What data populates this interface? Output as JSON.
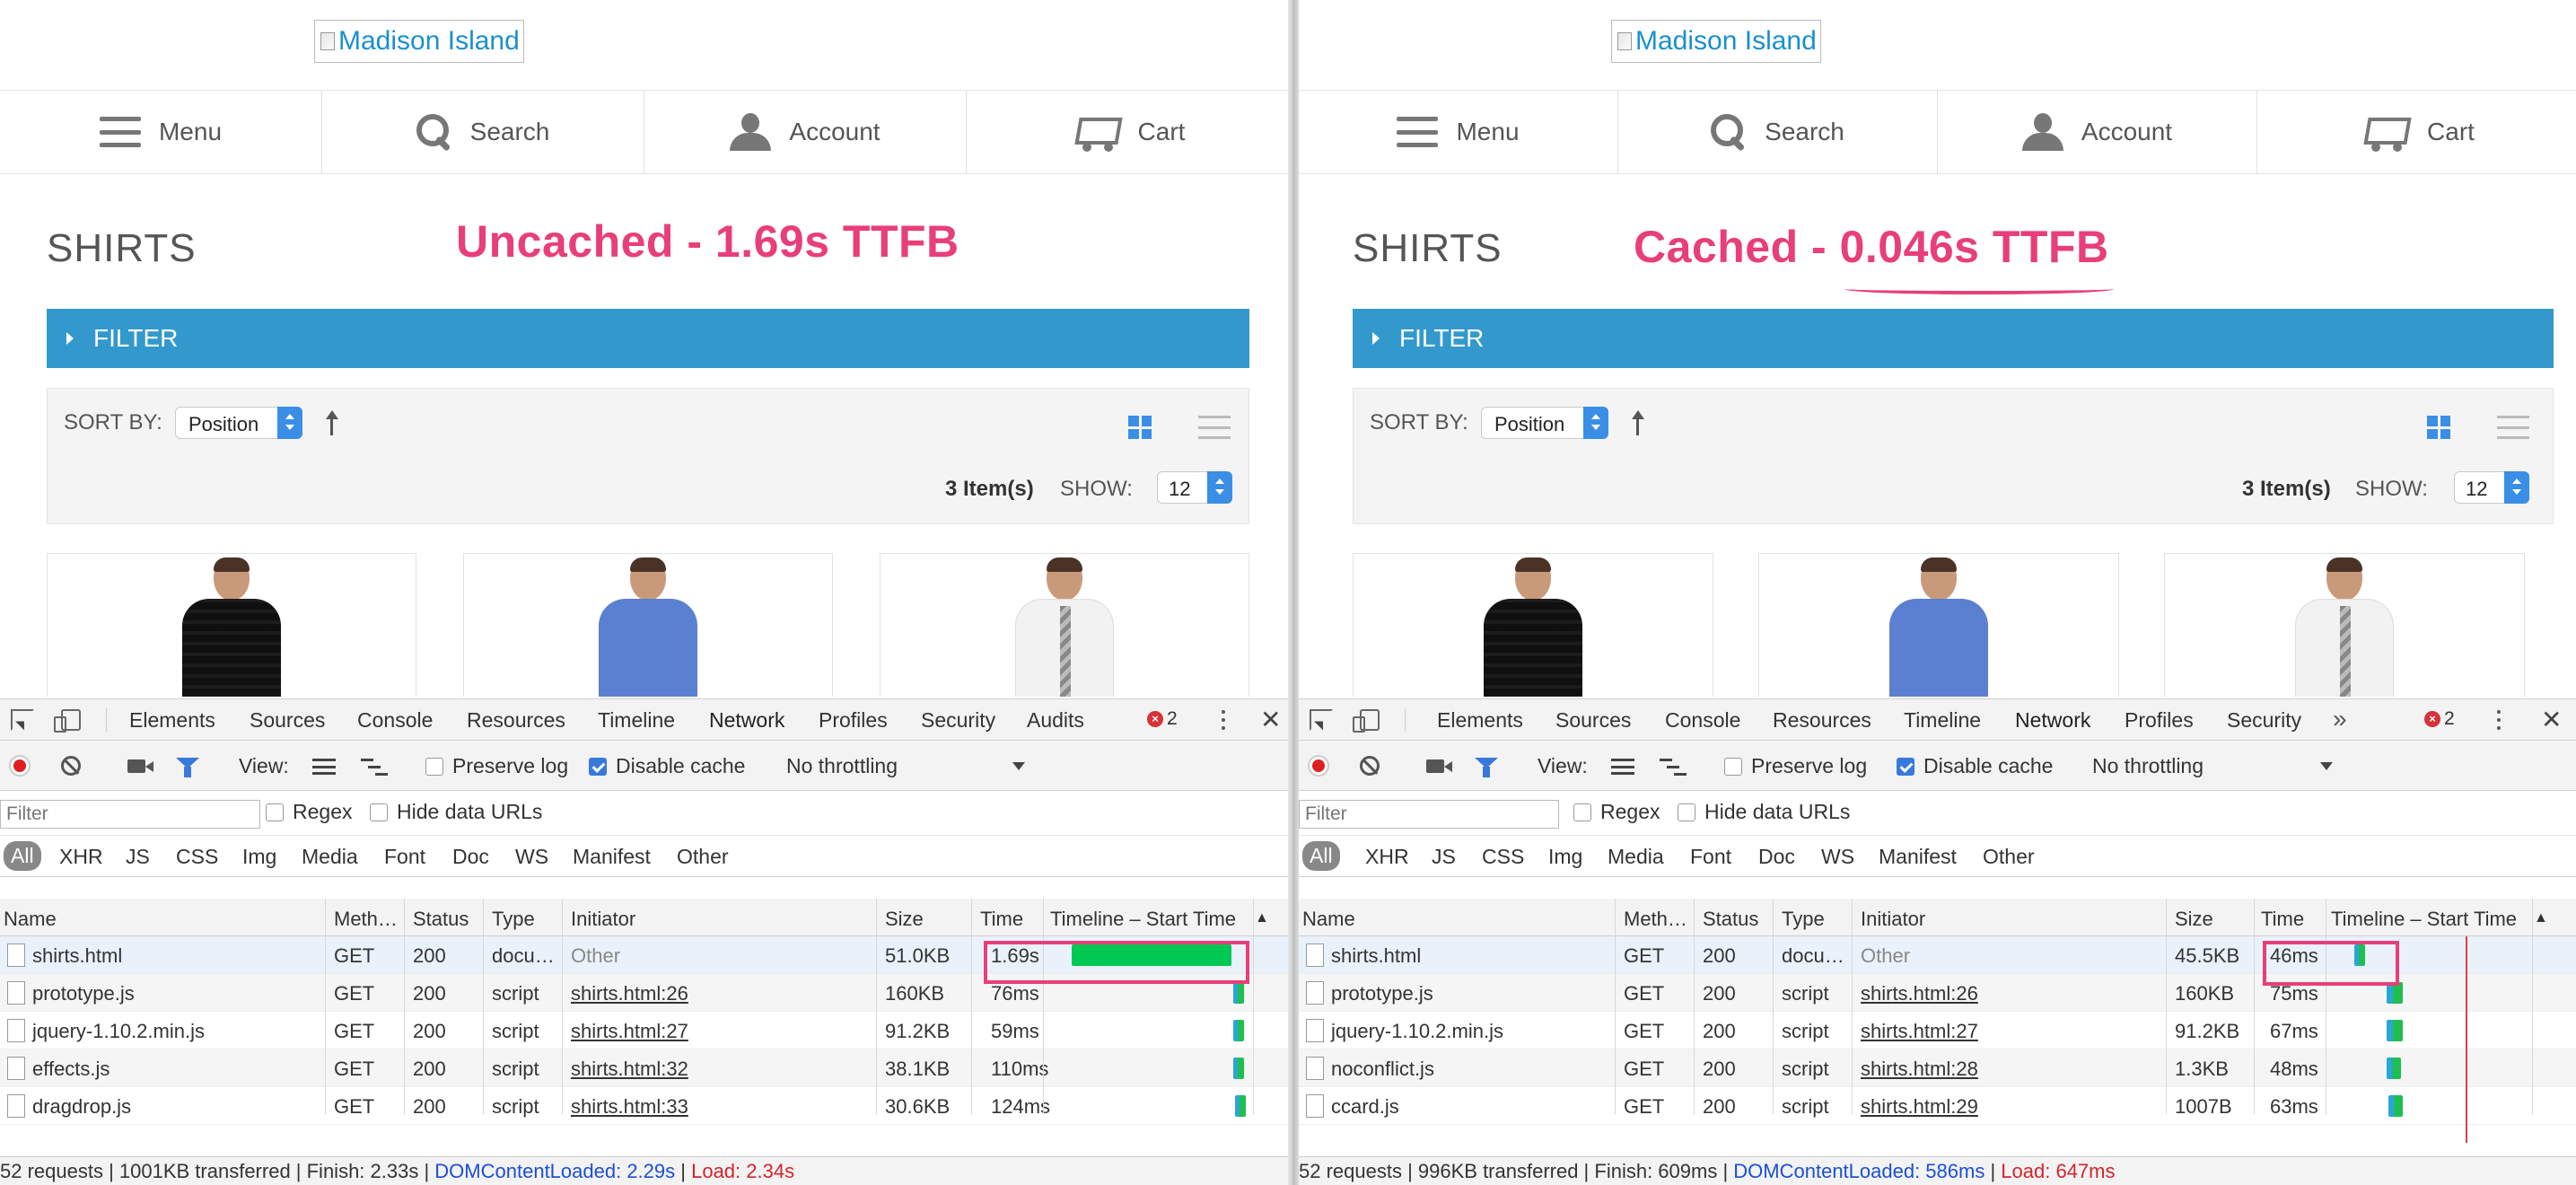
{
  "site": {
    "logo_alt": "Madison Island",
    "nav": [
      "Menu",
      "Search",
      "Account",
      "Cart"
    ],
    "category_title": "SHIRTS",
    "filter_label": "FILTER",
    "sort_by_label": "SORT BY:",
    "sort_value": "Position",
    "items_count": "3 Item(s)",
    "show_label": "SHOW:",
    "show_value": "12"
  },
  "annotations": {
    "left": "Uncached - 1.69s TTFB",
    "right_prefix": "Cached - ",
    "right_value": "0.046s TTFB"
  },
  "accent_color": "#e83e7a",
  "devtools": {
    "tabs_left": [
      "Elements",
      "Sources",
      "Console",
      "Resources",
      "Timeline",
      "Network",
      "Profiles",
      "Security",
      "Audits"
    ],
    "tabs_right": [
      "Elements",
      "Sources",
      "Console",
      "Resources",
      "Timeline",
      "Network",
      "Profiles",
      "Security"
    ],
    "more_tabs": "»",
    "active_tab": "Network",
    "error_count": "2",
    "close": "✕",
    "view_label": "View:",
    "preserve_log": "Preserve log",
    "disable_cache": "Disable cache",
    "throttling": "No throttling",
    "filter_placeholder": "Filter",
    "regex": "Regex",
    "hide_data_urls": "Hide data URLs",
    "types": [
      "All",
      "XHR",
      "JS",
      "CSS",
      "Img",
      "Media",
      "Font",
      "Doc",
      "WS",
      "Manifest",
      "Other"
    ],
    "columns": [
      "Name",
      "Meth…",
      "Status",
      "Type",
      "Initiator",
      "Size",
      "Time",
      "Timeline – Start Time"
    ],
    "sort_marker": "▲"
  },
  "left_requests": [
    {
      "name": "shirts.html",
      "method": "GET",
      "status": "200",
      "type": "docu…",
      "initiator": "Other",
      "size": "51.0KB",
      "time": "1.69s"
    },
    {
      "name": "prototype.js",
      "method": "GET",
      "status": "200",
      "type": "script",
      "initiator": "shirts.html:26",
      "size": "160KB",
      "time": "76ms"
    },
    {
      "name": "jquery-1.10.2.min.js",
      "method": "GET",
      "status": "200",
      "type": "script",
      "initiator": "shirts.html:27",
      "size": "91.2KB",
      "time": "59ms"
    },
    {
      "name": "effects.js",
      "method": "GET",
      "status": "200",
      "type": "script",
      "initiator": "shirts.html:32",
      "size": "38.1KB",
      "time": "110ms"
    },
    {
      "name": "dragdrop.js",
      "method": "GET",
      "status": "200",
      "type": "script",
      "initiator": "shirts.html:33",
      "size": "30.6KB",
      "time": "124ms"
    }
  ],
  "right_requests": [
    {
      "name": "shirts.html",
      "method": "GET",
      "status": "200",
      "type": "docu…",
      "initiator": "Other",
      "size": "45.5KB",
      "time": "46ms"
    },
    {
      "name": "prototype.js",
      "method": "GET",
      "status": "200",
      "type": "script",
      "initiator": "shirts.html:26",
      "size": "160KB",
      "time": "75ms"
    },
    {
      "name": "jquery-1.10.2.min.js",
      "method": "GET",
      "status": "200",
      "type": "script",
      "initiator": "shirts.html:27",
      "size": "91.2KB",
      "time": "67ms"
    },
    {
      "name": "noconflict.js",
      "method": "GET",
      "status": "200",
      "type": "script",
      "initiator": "shirts.html:28",
      "size": "1.3KB",
      "time": "48ms"
    },
    {
      "name": "ccard.js",
      "method": "GET",
      "status": "200",
      "type": "script",
      "initiator": "shirts.html:29",
      "size": "1007B",
      "time": "63ms"
    }
  ],
  "left_status": {
    "summary": "52 requests | 1001KB transferred | Finish: 2.33s | ",
    "dcl": "DOMContentLoaded: 2.29s",
    "sep": " | ",
    "load": "Load: 2.34s"
  },
  "right_status": {
    "summary": "52 requests | 996KB transferred | Finish: 609ms | ",
    "dcl": "DOMContentLoaded: 586ms",
    "sep": " | ",
    "load": "Load: 647ms"
  }
}
